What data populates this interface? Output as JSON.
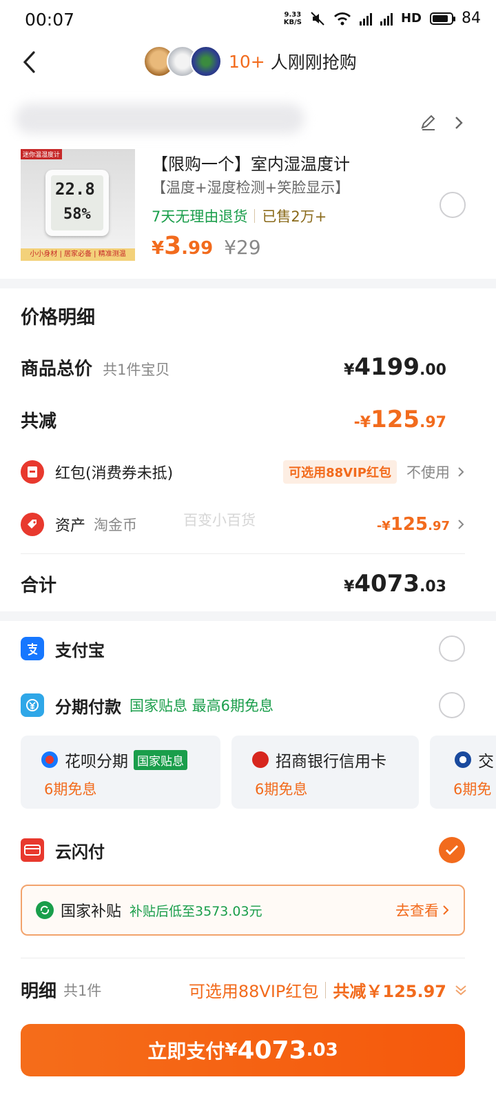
{
  "status": {
    "time": "00:07",
    "net_speed": "9.33\nKB/S",
    "net_speed_top": "9.33",
    "net_speed_bottom": "KB/S",
    "hd_label": "HD",
    "battery": "84"
  },
  "header": {
    "count": "10+",
    "text": "人刚刚抢购"
  },
  "product": {
    "title": "【限购一个】室内湿温度计",
    "subtitle": "【温度+湿度检测+笑脸显示】",
    "return_tag": "7天无理由退货",
    "sold_tag": "已售2万+",
    "price_currency": "¥",
    "price_int": "3",
    "price_dec": ".99",
    "original_price": "¥29",
    "thumb_tag": "迷你温湿度计",
    "thumb_temp": "22.8",
    "thumb_humidity": "58%",
    "thumb_banner": "小小身材 | 居家必备 | 精准测温"
  },
  "price_detail": {
    "title": "价格明细",
    "goods_total_label": "商品总价",
    "goods_total_sub": "共1件宝贝",
    "goods_total_cur": "¥",
    "goods_total_int": "4199",
    "goods_total_dec": ".00",
    "reduce_label": "共减",
    "reduce_cur": "-¥",
    "reduce_int": "125",
    "reduce_dec": ".97",
    "redpacket_label": "红包(消费券未抵)",
    "redpacket_badge": "可选用88VIP红包",
    "redpacket_status": "不使用",
    "asset_label": "资产",
    "asset_sub": "淘金币",
    "asset_cur": "-¥",
    "asset_int": "125",
    "asset_dec": ".97",
    "sum_label": "合计",
    "sum_cur": "¥",
    "sum_int": "4073",
    "sum_dec": ".03"
  },
  "watermark": "百变小百货",
  "payment": {
    "alipay_label": "支付宝",
    "installment_label": "分期付款",
    "installment_promo": "国家贴息 最高6期免息",
    "cards": [
      {
        "name": "花呗分期",
        "badge": "国家贴息",
        "term": "6期免息"
      },
      {
        "name": "招商银行信用卡",
        "badge": "",
        "term": "6期免息"
      },
      {
        "name": "交",
        "badge": "",
        "term": "6期免"
      }
    ],
    "unionpay_label": "云闪付",
    "subsidy_title": "国家补贴",
    "subsidy_desc": "补贴后低至3573.03元",
    "subsidy_link": "去查看"
  },
  "footer": {
    "detail_label": "明细",
    "detail_count": "共1件",
    "vip_text": "可选用88VIP红包",
    "reduce_text": "共减￥125.97",
    "pay_label": "立即支付",
    "pay_cur": "¥",
    "pay_int": "4073",
    "pay_dec": ".03"
  },
  "colors": {
    "accent": "#f26b1d",
    "green": "#1a9e4b",
    "alipay_blue": "#1677ff",
    "installment_blue": "#2fa7e8",
    "unionpay_red": "#e8392e"
  }
}
